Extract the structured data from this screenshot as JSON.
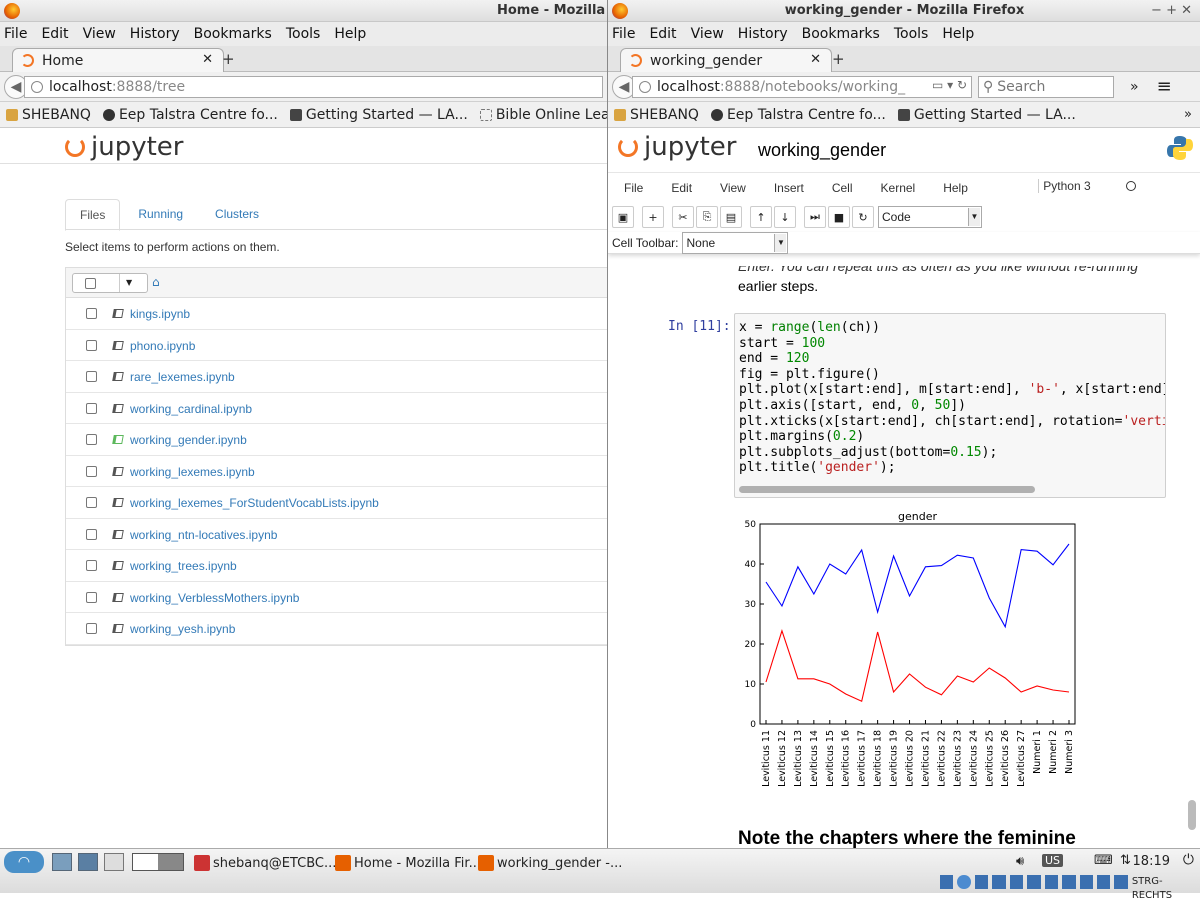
{
  "left": {
    "title": "Home - Mozilla",
    "menu": [
      "File",
      "Edit",
      "View",
      "History",
      "Bookmarks",
      "Tools",
      "Help"
    ],
    "tab_label": "Home",
    "url_host": "localhost",
    "url_rest": ":8888/tree",
    "bookmarks": [
      "SHEBANQ",
      "Eep Talstra Centre fo...",
      "Getting Started — LA...",
      "Bible Online Learner"
    ],
    "logo_text": "jupyter",
    "tabs": [
      "Files",
      "Running",
      "Clusters"
    ],
    "hint": "Select items to perform actions on them.",
    "files": [
      "kings.ipynb",
      "phono.ipynb",
      "rare_lexemes.ipynb",
      "working_cardinal.ipynb",
      "working_gender.ipynb",
      "working_lexemes.ipynb",
      "working_lexemes_ForStudentVocabLists.ipynb",
      "working_ntn-locatives.ipynb",
      "working_trees.ipynb",
      "working_VerblessMothers.ipynb",
      "working_yesh.ipynb"
    ]
  },
  "right": {
    "title": "working_gender - Mozilla Firefox",
    "window_controls": "− + ✕",
    "menu": [
      "File",
      "Edit",
      "View",
      "History",
      "Bookmarks",
      "Tools",
      "Help"
    ],
    "tab_label": "working_gender",
    "url_host": "localhost",
    "url_rest": ":8888/notebooks/working_",
    "search_placeholder": "Search",
    "bookmarks": [
      "SHEBANQ",
      "Eep Talstra Centre fo...",
      "Getting Started — LA..."
    ],
    "logo_text": "jupyter",
    "notebook_title": "working_gender",
    "nb_menu": [
      "File",
      "Edit",
      "View",
      "Insert",
      "Cell",
      "Kernel",
      "Help"
    ],
    "kernel": "Python 3",
    "cell_type": "Code",
    "cell_toolbar_label": "Cell Toolbar:",
    "cell_toolbar_value": "None",
    "md_top_1": "Enter. You can repeat this as often as you like without re-running",
    "md_top_2": "earlier steps.",
    "prompt": "In [11]:",
    "md_bottom": "Note the chapters where the feminine"
  },
  "chart_data": {
    "type": "line",
    "title": "gender",
    "xlabel": "",
    "ylabel": "",
    "ylim": [
      0,
      50
    ],
    "yticks": [
      0,
      10,
      20,
      30,
      40,
      50
    ],
    "categories": [
      "Leviticus 11",
      "Leviticus 12",
      "Leviticus 13",
      "Leviticus 14",
      "Leviticus 15",
      "Leviticus 16",
      "Leviticus 17",
      "Leviticus 18",
      "Leviticus 19",
      "Leviticus 20",
      "Leviticus 21",
      "Leviticus 22",
      "Leviticus 23",
      "Leviticus 24",
      "Leviticus 25",
      "Leviticus 26",
      "Leviticus 27",
      "Numeri 1",
      "Numeri 2",
      "Numeri 3"
    ],
    "series": [
      {
        "color": "#0000ff",
        "values": [
          35.5,
          29.5,
          39.3,
          32.5,
          40,
          37.5,
          43.5,
          28,
          42,
          32,
          39.3,
          39.6,
          42.2,
          41.5,
          31.5,
          24.3,
          43.6,
          43.2,
          39.8,
          45
        ]
      },
      {
        "color": "#ff0000",
        "values": [
          10.5,
          23.3,
          11.3,
          11.3,
          10,
          7.5,
          5.7,
          23,
          8,
          12.5,
          9.2,
          7.3,
          12,
          10.5,
          14,
          11.5,
          8,
          9.5,
          8.5,
          8
        ]
      }
    ]
  },
  "taskbar": {
    "items": [
      "shebanq@ETCBC...",
      "Home - Mozilla Fir...",
      "working_gender -..."
    ],
    "kbd": "US",
    "time": "18:19",
    "tray_label": "STRG-RECHTS"
  }
}
